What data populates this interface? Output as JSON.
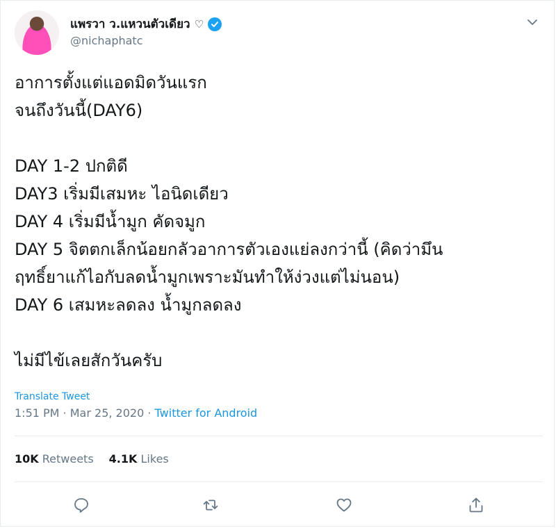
{
  "user": {
    "display_name": "แพรวา ว.แหวนตัวเดียว",
    "heart": "♡",
    "handle": "@nichaphatc"
  },
  "tweet": {
    "text": "อาการตั้งแต่แอดมิดวันแรก\nจนถึงวันนี้(DAY6)\n\nDAY 1-2 ปกติดี\nDAY3 เริ่มมีเสมหะ ไอนิดเดียว\nDAY 4 เริ่มมีน้ำมูก คัดจมูก\nDAY 5 จิตตกเล็กน้อยกลัวอาการตัวเองแย่ลงกว่านี้ (คิดว่ามึน\nฤทธิ์ยาแก้ไอกับลดน้ำมูกเพราะมันทำให้ง่วงแต่ไม่นอน)\nDAY 6 เสมหะลดลง น้ำมูกลดลง\n\nไม่มีไข้เลยสักวันครับ",
    "translate_label": "Translate Tweet",
    "time": "1:51 PM",
    "separator1": " · ",
    "date": "Mar 25, 2020",
    "separator2": " · ",
    "source": "Twitter for Android"
  },
  "stats": {
    "retweets_count": "10K",
    "retweets_label": "Retweets",
    "likes_count": "4.1K",
    "likes_label": "Likes"
  },
  "icons": {
    "verified": "verified-badge-icon",
    "chevron": "chevron-down-icon",
    "reply": "reply-icon",
    "retweet": "retweet-icon",
    "like": "heart-icon",
    "share": "share-icon"
  },
  "colors": {
    "link": "#1b95e0",
    "verified": "#1da1f2",
    "secondary_text": "#657786"
  }
}
